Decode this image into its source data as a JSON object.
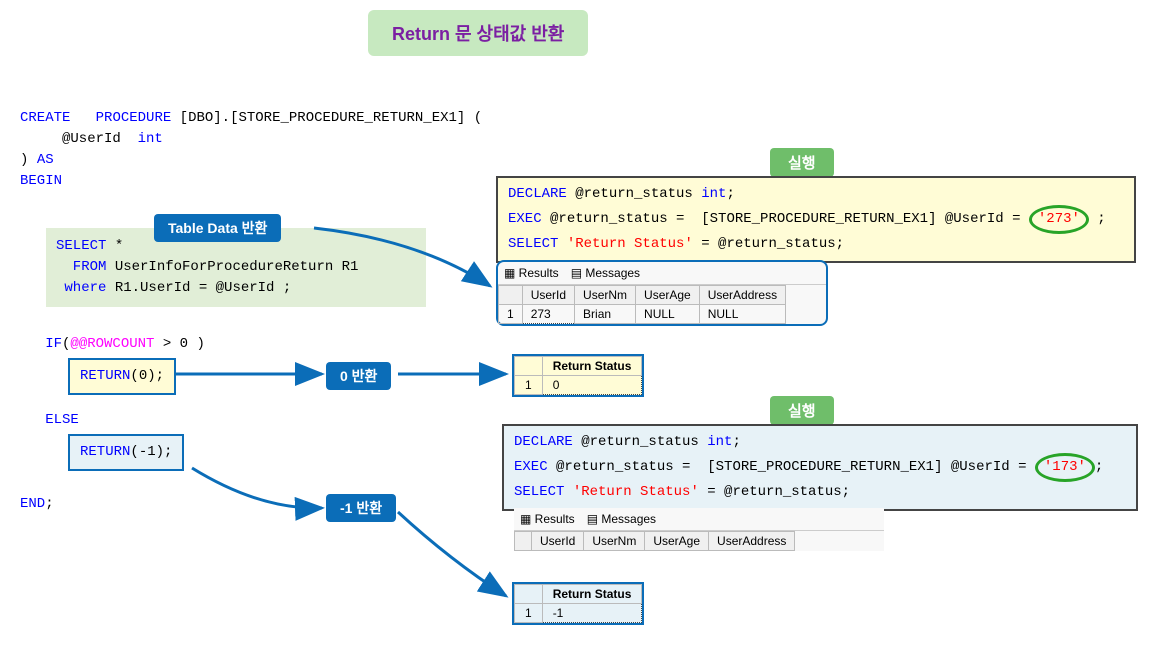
{
  "title": "Return 문  상태값 반환",
  "labels": {
    "run": "실행",
    "tableData": "Table Data 반환",
    "return0": "0  반환",
    "returnMinus1": "-1  반환"
  },
  "procedure": {
    "line1_create": "CREATE",
    "line1_procedure": "PROCEDURE",
    "line1_name": " [DBO].[STORE_PROCEDURE_RETURN_EX1] (",
    "line2_param": "     @UserId  ",
    "line2_type": "int",
    "line3_paren": ") ",
    "line3_as": "AS",
    "line4_begin": "BEGIN",
    "select": {
      "kw_select": "SELECT",
      "star": " *",
      "kw_from": "  FROM",
      "table": " UserInfoForProcedureReturn R1",
      "kw_where": " where",
      "cond": " R1.UserId = @UserId ;"
    },
    "if_kw": "   IF",
    "if_cond1": "(",
    "if_rowcount": "@@ROWCOUNT",
    "if_cond2": " > 0 )",
    "return0_kw": "RETURN",
    "return0_val": "(0);",
    "else_kw": "   ELSE",
    "return1_kw": "RETURN",
    "return1_val": "(-1);",
    "end": "END",
    "end_semi": ";"
  },
  "exec1": {
    "declare": "DECLARE",
    "var": " @return_status ",
    "intkw": "int",
    "semi1": ";",
    "exec": "EXEC",
    "assign": " @return_status =  [STORE_PROCEDURE_RETURN_EX1] @UserId = ",
    "val": "'273'",
    "semi2": " ;",
    "select": "SELECT",
    "label": " 'Return Status'",
    "eq": " = @return_status;"
  },
  "exec2": {
    "declare": "DECLARE",
    "var": " @return_status ",
    "intkw": "int",
    "semi1": ";",
    "exec": "EXEC",
    "assign": " @return_status =  [STORE_PROCEDURE_RETURN_EX1] @UserId = ",
    "val": "'173'",
    "semi2": ";",
    "select": "SELECT",
    "label": " 'Return Status'",
    "eq": " = @return_status;"
  },
  "results": {
    "tabResults": "Results",
    "tabMessages": "Messages",
    "cols": [
      "UserId",
      "UserNm",
      "UserAge",
      "UserAddress"
    ],
    "row1": [
      "1",
      "273",
      "Brian",
      "NULL",
      "NULL"
    ],
    "statusCol": "Return Status",
    "status0": [
      "1",
      "0"
    ],
    "statusMinus1": [
      "1",
      "-1"
    ]
  }
}
